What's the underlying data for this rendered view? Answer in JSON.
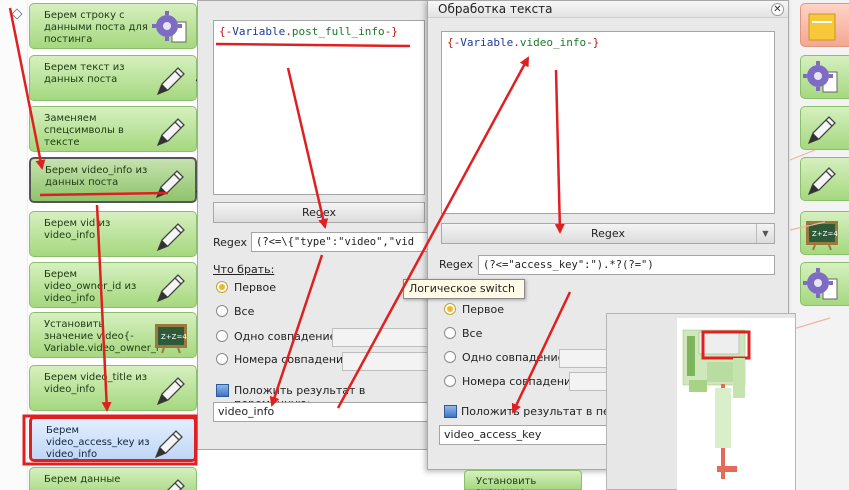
{
  "left_blocks": [
    {
      "label": "Берем строку с данными поста для постинга",
      "icon": "gear-document-icon"
    },
    {
      "label": "Берем текст из данных поста",
      "icon": "pen-icon"
    },
    {
      "label": "Заменяем спецсимволы в тексте",
      "icon": "pen-icon"
    },
    {
      "label": "Берем video_info из данных поста",
      "icon": "pen-icon"
    },
    {
      "label": "Берем vid из video_info",
      "icon": "pen-icon"
    },
    {
      "label": "Берем video_owner_id из video_info",
      "icon": "pen-icon"
    },
    {
      "label": "Установить значение video{-Variable.video_owner_i",
      "icon": "chalkboard-icon"
    },
    {
      "label": "Берем video_title из video_info",
      "icon": "pen-icon"
    },
    {
      "label": "Берем video_access_key из video_info",
      "icon": "pen-icon"
    },
    {
      "label": "Берем данные",
      "icon": "pen-icon"
    }
  ],
  "right_blocks": [
    {
      "icon": "sticky-note-icon"
    },
    {
      "icon": "gear-document-icon"
    },
    {
      "icon": "pen-icon"
    },
    {
      "icon": "pen-icon"
    },
    {
      "icon": "chalkboard-icon"
    },
    {
      "icon": "gear-document-icon"
    }
  ],
  "dialog1": {
    "editor_text": "{-Variable.post_full_info-}",
    "regex_button": "Regex",
    "regex_label": "Regex",
    "regex_value": "(?<=\\{\"type\":\"video\",\"vid",
    "what_to_take": "Что брать:",
    "options": [
      "Первое",
      "Все",
      "Одно совпадение",
      "Номера совпадений"
    ],
    "selected_option": "Первое",
    "store_label": "Положить результат в переменную:",
    "store_value": "video_info"
  },
  "dialog2": {
    "title": "Обработка текста",
    "editor_text": "{-Variable.video_info-}",
    "regex_button": "Regex",
    "regex_label": "Regex",
    "regex_value": "(?<=\"access_key\":\").*?(?=\")",
    "options": [
      "Первое",
      "Все",
      "Одно совпадение",
      "Номера совпадений"
    ],
    "selected_option": "Первое",
    "store_label": "Положить результат в переме",
    "store_value": "video_access_key"
  },
  "tooltip": {
    "text": "Логическое switch"
  },
  "bottom_block": {
    "label": "Установить значение"
  },
  "colors": {
    "annotation": "#e02020",
    "block_green": "#a5d87f",
    "highlight_border": "#e02020"
  }
}
